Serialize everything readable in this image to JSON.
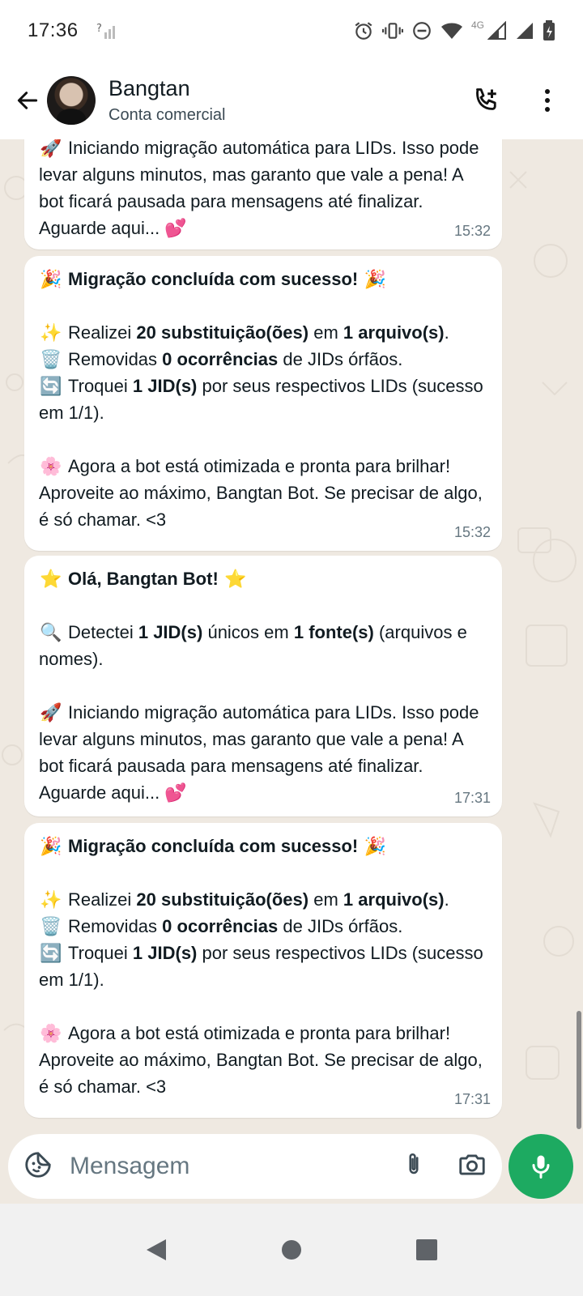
{
  "status_bar": {
    "time": "17:36",
    "network": "4G"
  },
  "header": {
    "contact_name": "Bangtan",
    "subtitle": "Conta comercial"
  },
  "messages": [
    {
      "lines": [
        {
          "emoji": "🚀",
          "text": "Iniciando migração automática para LIDs. Isso pode levar alguns minutos, mas garanto que vale a pena! A bot ficará pausada para mensagens até finalizar. Aguarde aqui... 💕"
        }
      ],
      "time": "15:32"
    },
    {
      "title": "Migração concluída com sucesso!",
      "title_emoji": "🎉",
      "r1_prefix": "Realizei",
      "r1_b1": "20 substituição(ões)",
      "r1_mid": "em",
      "r1_b2": "1 arquivo(s)",
      "r1_end": ".",
      "r2_prefix": "Removidas",
      "r2_b1": "0 ocorrências",
      "r2_end": "de JIDs órfãos.",
      "r3_prefix": "Troquei",
      "r3_b1": "1 JID(s)",
      "r3_end": "por seus respectivos LIDs (sucesso em 1/1).",
      "closing": "Agora a bot está otimizada e pronta para brilhar! Aproveite ao máximo, Bangtan Bot. Se precisar de algo, é só chamar. <3",
      "time": "15:32"
    },
    {
      "title": "Olá, Bangtan Bot!",
      "title_emoji": "⭐",
      "d_prefix": "Detectei",
      "d_b1": "1 JID(s)",
      "d_mid": "únicos em",
      "d_b2": "1 fonte(s)",
      "d_end": "(arquivos e nomes).",
      "rocket_text": "Iniciando migração automática para LIDs. Isso pode levar alguns minutos, mas garanto que vale a pena! A bot ficará pausada para mensagens até finalizar. Aguarde aqui... 💕",
      "time": "17:31"
    },
    {
      "title": "Migração concluída com sucesso!",
      "title_emoji": "🎉",
      "r1_prefix": "Realizei",
      "r1_b1": "20 substituição(ões)",
      "r1_mid": "em",
      "r1_b2": "1 arquivo(s)",
      "r1_end": ".",
      "r2_prefix": "Removidas",
      "r2_b1": "0 ocorrências",
      "r2_end": "de JIDs órfãos.",
      "r3_prefix": "Troquei",
      "r3_b1": "1 JID(s)",
      "r3_end": "por seus respectivos LIDs (sucesso em 1/1).",
      "closing": "Agora a bot está otimizada e pronta para brilhar! Aproveite ao máximo, Bangtan Bot. Se precisar de algo, é só chamar. <3",
      "time": "17:31"
    }
  ],
  "input": {
    "placeholder": "Mensagem"
  },
  "icons": {
    "back": "arrow-left-icon",
    "add_call": "add-call-icon",
    "menu": "more-vert-icon",
    "emoji": "sticker-icon",
    "attach": "paperclip-icon",
    "camera": "camera-icon",
    "mic": "mic-icon"
  },
  "colors": {
    "accent_green": "#1daa61",
    "chat_background": "#efe9e1",
    "bubble": "#ffffff",
    "timestamp": "#667781"
  }
}
